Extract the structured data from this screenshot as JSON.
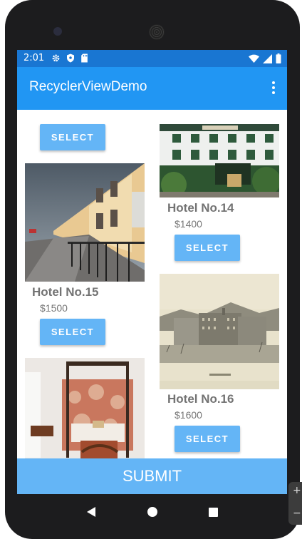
{
  "status_bar": {
    "time": "2:01",
    "left_icons": [
      "gear-icon",
      "shield-icon",
      "sd-card-icon"
    ],
    "right_icons": [
      "wifi-icon",
      "signal-icon",
      "battery-icon"
    ]
  },
  "app_bar": {
    "title": "RecyclerViewDemo",
    "menu_icon": "overflow-menu-icon"
  },
  "hotels": [
    {
      "select_label": "SELECT"
    },
    {
      "name": "Hotel No.14",
      "price": "$1400",
      "select_label": "SELECT"
    },
    {
      "name": "Hotel No.15",
      "price": "$1500",
      "select_label": "SELECT"
    },
    {
      "name": "Hotel No.16",
      "price": "$1600",
      "select_label": "SELECT"
    },
    {
      "name": "",
      "price": "",
      "select_label": ""
    }
  ],
  "submit_label": "SUBMIT",
  "nav": {
    "back": "back-icon",
    "home": "home-icon",
    "recents": "recents-icon"
  },
  "colors": {
    "status_bar": "#1976d2",
    "app_bar": "#2196f3",
    "button": "#64b5f6",
    "hotel_name": "#737373"
  }
}
